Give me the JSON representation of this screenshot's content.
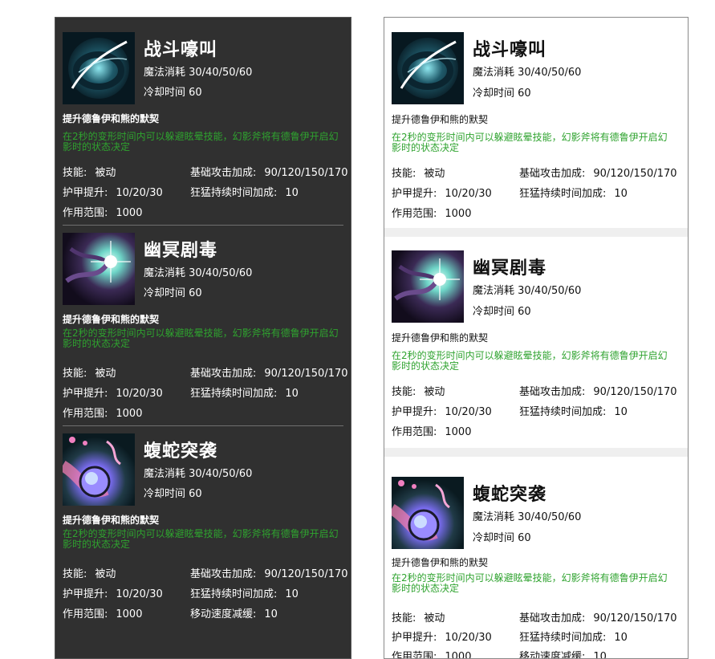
{
  "colors": {
    "dark_panel_bg": "#303030",
    "light_panel_bg": "#ffffff",
    "lore_green": "#2fa32f",
    "separator_gray": "#efefef"
  },
  "skills": [
    {
      "name": "战斗嚎叫",
      "icon": "battle-cry-icon",
      "mana": "魔法消耗 30/40/50/60",
      "cooldown": "冷却时间 60",
      "desc": "提升德鲁伊和熊的默契",
      "lore": "在2秒的变形时间内可以躲避眩晕技能，幻影斧将有德鲁伊开启幻影时的状态决定",
      "attrs": [
        {
          "k": "技能:",
          "v": "被动"
        },
        {
          "k": "基础攻击加成:",
          "v": "90/120/150/170"
        },
        {
          "k": "护甲提升:",
          "v": "10/20/30"
        },
        {
          "k": "狂猛持续时间加成:",
          "v": "10"
        },
        {
          "k": "作用范围:",
          "v": "1000"
        }
      ]
    },
    {
      "name": "幽冥剧毒",
      "icon": "nether-poison-icon",
      "mana": "魔法消耗 30/40/50/60",
      "cooldown": "冷却时间 60",
      "desc": "提升德鲁伊和熊的默契",
      "lore": "在2秒的变形时间内可以躲避眩晕技能，幻影斧将有德鲁伊开启幻影时的状态决定",
      "attrs": [
        {
          "k": "技能:",
          "v": "被动"
        },
        {
          "k": "基础攻击加成:",
          "v": "90/120/150/170"
        },
        {
          "k": "护甲提升:",
          "v": "10/20/30"
        },
        {
          "k": "狂猛持续时间加成:",
          "v": "10"
        },
        {
          "k": "作用范围:",
          "v": "1000"
        }
      ]
    },
    {
      "name": "蝮蛇突袭",
      "icon": "viper-strike-icon",
      "mana": "魔法消耗 30/40/50/60",
      "cooldown": "冷却时间 60",
      "desc": "提升德鲁伊和熊的默契",
      "lore": "在2秒的变形时间内可以躲避眩晕技能，幻影斧将有德鲁伊开启幻影时的状态决定",
      "attrs": [
        {
          "k": "技能:",
          "v": "被动"
        },
        {
          "k": "基础攻击加成:",
          "v": "90/120/150/170"
        },
        {
          "k": "护甲提升:",
          "v": "10/20/30"
        },
        {
          "k": "狂猛持续时间加成:",
          "v": "10"
        },
        {
          "k": "作用范围:",
          "v": "1000"
        },
        {
          "k": "移动速度减缓:",
          "v": "10"
        }
      ]
    }
  ]
}
